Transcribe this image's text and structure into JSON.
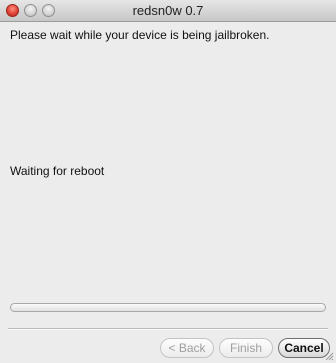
{
  "window": {
    "title": "redsn0w 0.7"
  },
  "content": {
    "message": "Please wait while your device is being jailbroken.",
    "status": "Waiting for reboot",
    "progress_fraction": 0.0
  },
  "buttons": {
    "back_label": "< Back",
    "finish_label": "Finish",
    "cancel_label": "Cancel"
  },
  "icons": {
    "close": "close-icon",
    "minimize": "minimize-icon",
    "zoom": "zoom-icon",
    "resize": "resize-grip-icon"
  },
  "colors": {
    "close_button": "#e0443a",
    "window_background": "#ececec"
  }
}
